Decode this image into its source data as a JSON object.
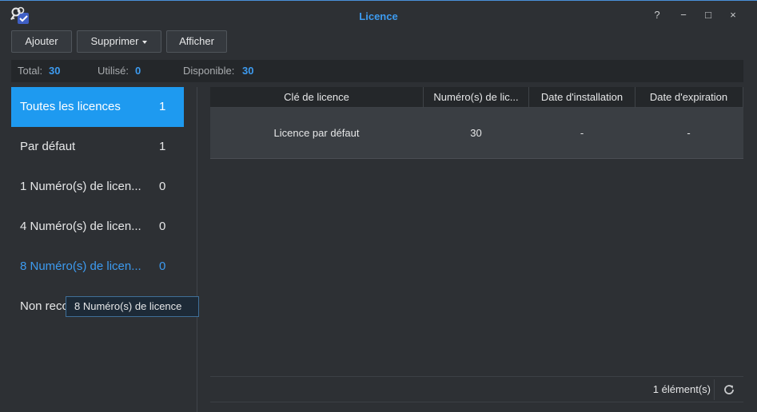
{
  "window": {
    "title": "Licence",
    "accent_color": "#3d9bf0",
    "controls": {
      "help": "?",
      "minimize": "−",
      "maximize": "□",
      "close": "×"
    }
  },
  "toolbar": {
    "add_label": "Ajouter",
    "delete_label": "Supprimer",
    "view_label": "Afficher"
  },
  "stats": {
    "total_label": "Total:",
    "total_value": "30",
    "used_label": "Utilisé:",
    "used_value": "0",
    "available_label": "Disponible:",
    "available_value": "30"
  },
  "categories": [
    {
      "label": "Toutes les licences",
      "count": "1",
      "state": "selected"
    },
    {
      "label": "Par défaut",
      "count": "1",
      "state": "normal"
    },
    {
      "label": "1 Numéro(s) de licen...",
      "count": "0",
      "state": "normal"
    },
    {
      "label": "4 Numéro(s) de licen...",
      "count": "0",
      "state": "normal"
    },
    {
      "label": "8 Numéro(s) de licen...",
      "count": "0",
      "state": "hover"
    },
    {
      "label": "Non reco",
      "count": "",
      "state": "normal"
    }
  ],
  "tooltip": {
    "text": "8 Numéro(s) de licence"
  },
  "grid": {
    "columns": [
      "Clé de licence",
      "Numéro(s) de lic...",
      "Date d'installation",
      "Date d'expiration"
    ],
    "rows": [
      {
        "key": "Licence par défaut",
        "number": "30",
        "install_date": "-",
        "expiration_date": "-"
      }
    ]
  },
  "footer": {
    "item_count": "1 élément(s)",
    "refresh_icon": "refresh-icon"
  }
}
